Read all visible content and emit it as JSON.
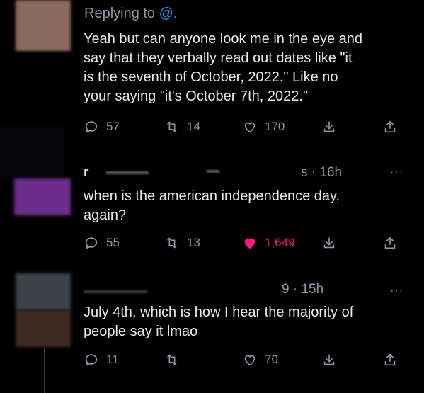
{
  "reply_context": {
    "prefix": "Replying to",
    "handle": "@."
  },
  "tweets": [
    {
      "text": "Yeah but can anyone look me in the eye and\nsay that they verbally read out dates like \"it\nis the seventh of October, 2022.\" Like no\nyour saying \"it's October 7th, 2022.\"",
      "stats": {
        "replies": "57",
        "retweets": "14",
        "likes": "170"
      },
      "liked": false
    },
    {
      "name": "r",
      "time": "s · 16h",
      "text": "when is the american independence day,\nagain?",
      "stats": {
        "replies": "55",
        "retweets": "13",
        "likes": "1,649"
      },
      "liked": true,
      "accent_color": "#f91880"
    },
    {
      "time": "9 · 15h",
      "text": "July 4th, which is how I hear the majority of\npeople say it lmao",
      "stats": {
        "replies": "11",
        "retweets": "",
        "likes": "70"
      },
      "liked": false
    }
  ],
  "more_label": "···",
  "icons": [
    "reply-icon",
    "retweet-icon",
    "like-icon",
    "download-icon",
    "share-icon"
  ],
  "colors": {
    "background": "#000000",
    "text": "#e7e9ea",
    "muted": "#8b98a5",
    "link": "#1d9bf0",
    "like": "#f91880"
  }
}
